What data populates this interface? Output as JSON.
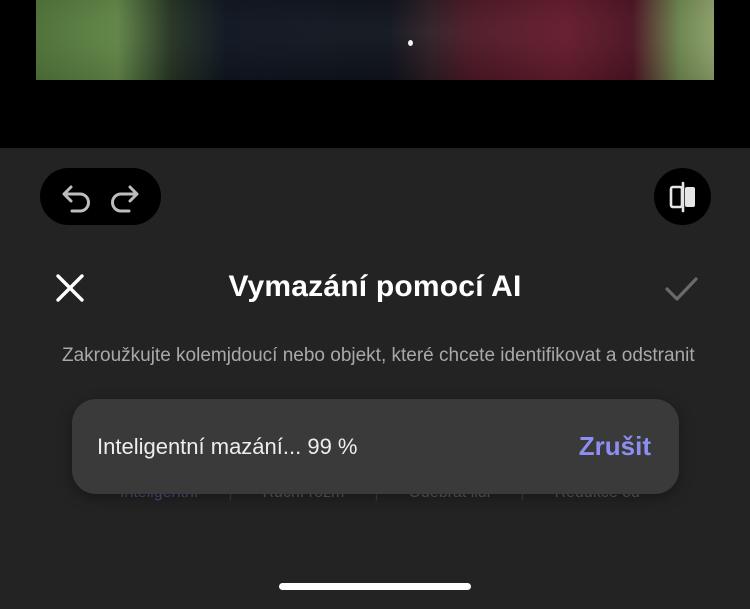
{
  "editor": {
    "title": "Vymazání pomocí AI",
    "instruction": "Zakroužkujte kolemjdoucí nebo objekt, které chcete identifikovat a odstranit"
  },
  "toolbar": {
    "undo_icon": "undo-icon",
    "redo_icon": "redo-icon",
    "compare_icon": "compare-icon",
    "close_icon": "close-icon",
    "confirm_icon": "check-icon"
  },
  "modes": {
    "items": [
      "Inteligentní",
      "Ruční rozm",
      "Odebrat lidi",
      "Redukce od"
    ],
    "active_index": 0
  },
  "progress": {
    "label": "Inteligentní mazání... 99 %",
    "percent": 99,
    "cancel_label": "Zrušit"
  },
  "colors": {
    "accent": "#8C8EF2",
    "panel_background": "#232323",
    "toast_background": "#3A3A3A"
  }
}
